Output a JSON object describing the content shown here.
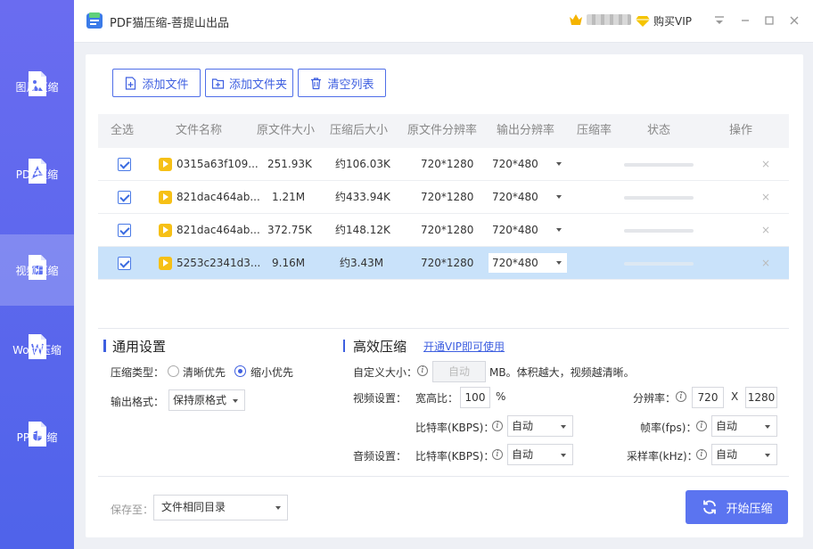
{
  "app": {
    "title": "PDF猫压缩-菩提山出品",
    "vip_label": "购买VIP"
  },
  "sidebar": {
    "items": [
      {
        "label": "图片压缩"
      },
      {
        "label": "PDF压缩"
      },
      {
        "label": "视频压缩"
      },
      {
        "label": "Word压缩"
      },
      {
        "label": "PPT压缩"
      }
    ]
  },
  "toolbar": {
    "add_file": "添加文件",
    "add_folder": "添加文件夹",
    "clear_list": "清空列表"
  },
  "table": {
    "headers": [
      "全选",
      "文件名称",
      "原文件大小",
      "压缩后大小",
      "原文件分辨率",
      "输出分辨率",
      "压缩率",
      "状态",
      "操作"
    ],
    "rows": [
      {
        "name": "0315a63f109...",
        "orig_size": "251.93K",
        "new_size": "约106.03K",
        "orig_res": "720*1280",
        "out_res": "720*480"
      },
      {
        "name": "821dac464ab...",
        "orig_size": "1.21M",
        "new_size": "约433.94K",
        "orig_res": "720*1280",
        "out_res": "720*480"
      },
      {
        "name": "821dac464ab...",
        "orig_size": "372.75K",
        "new_size": "约148.12K",
        "orig_res": "720*1280",
        "out_res": "720*480"
      },
      {
        "name": "5253c2341d3...",
        "orig_size": "9.16M",
        "new_size": "约3.43M",
        "orig_res": "720*1280",
        "out_res": "720*480"
      }
    ],
    "delete_symbol": "×"
  },
  "general": {
    "title": "通用设置",
    "type_label": "压缩类型：",
    "opt_clear": "清晰优先",
    "opt_small": "缩小优先",
    "format_label": "输出格式：",
    "format_value": "保持原格式"
  },
  "advanced": {
    "title": "高效压缩",
    "vip_link": "开通VIP即可使用",
    "custom_size_label": "自定义大小：",
    "custom_size_value": "自动",
    "custom_size_hint": "MB。体积越大，视频越清晰。",
    "video_label": "视频设置：",
    "aspect_label": "宽高比：",
    "aspect_value": "100",
    "aspect_unit": "%",
    "resolution_label": "分辨率：",
    "res_w": "720",
    "res_x": "X",
    "res_h": "1280",
    "bitrate_label": "比特率(KBPS)：",
    "bitrate_value": "自动",
    "fps_label": "帧率(fps)：",
    "fps_value": "自动",
    "audio_label": "音频设置：",
    "audio_bitrate_label": "比特率(KBPS)：",
    "audio_bitrate_value": "自动",
    "sample_label": "采样率(kHz)：",
    "sample_value": "自动"
  },
  "footer": {
    "save_label": "保存至：",
    "save_value": "文件相同目录",
    "start_label": "开始压缩"
  }
}
